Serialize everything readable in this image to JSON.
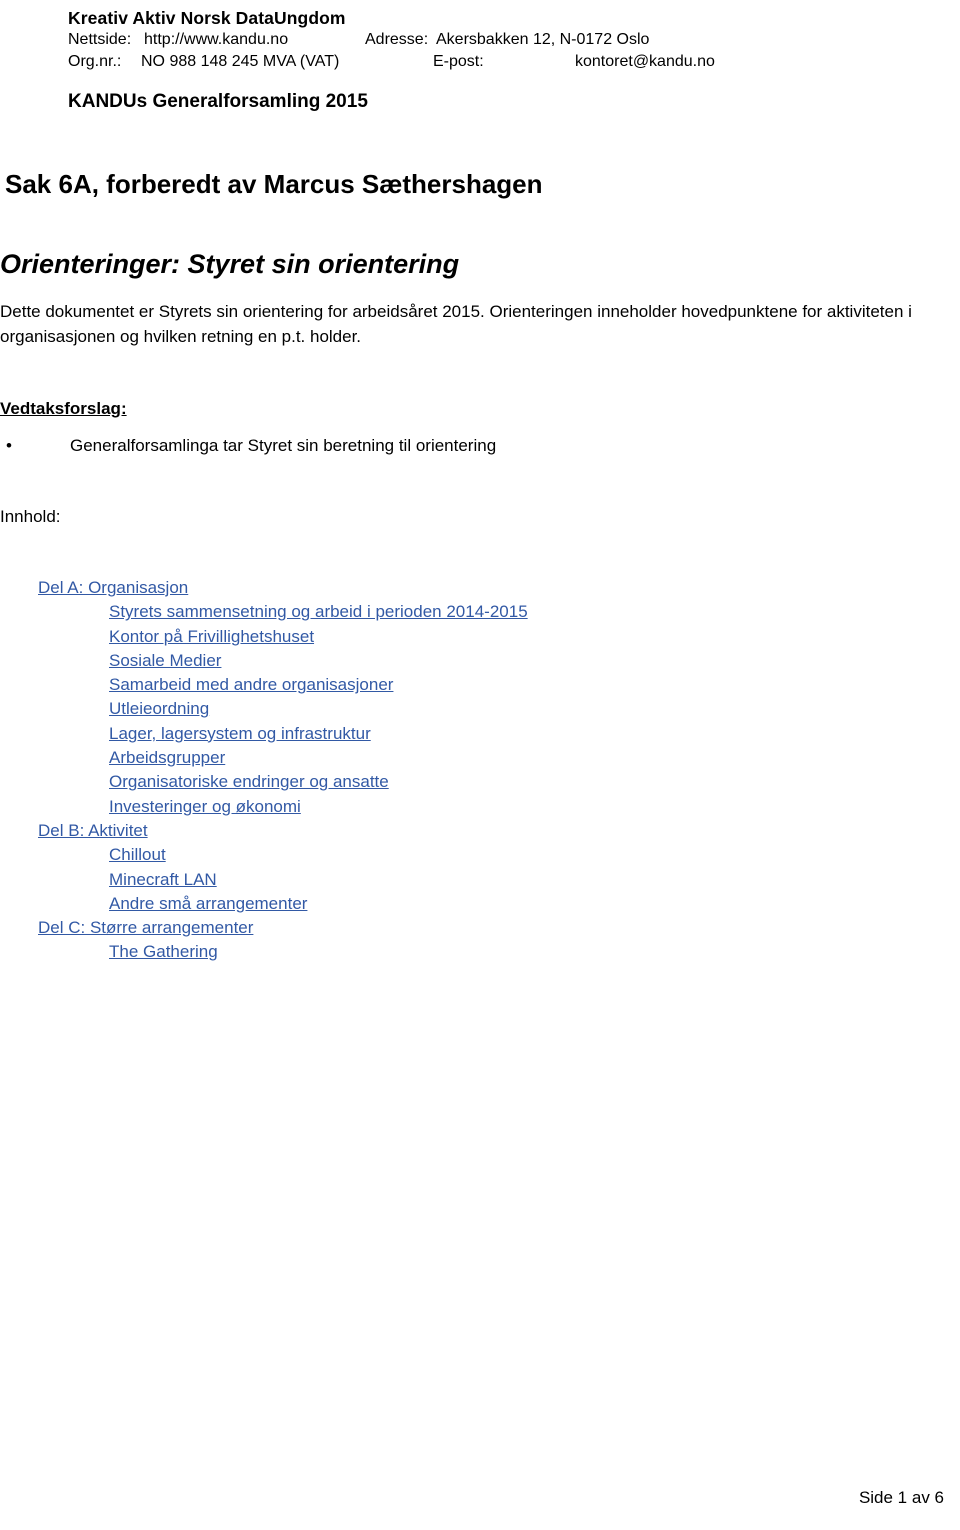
{
  "letterhead": {
    "organization": "Kreativ Aktiv Norsk DataUngdom",
    "website_label": "Nettside:",
    "website_value": "http://www.kandu.no",
    "address_label": "Adresse:",
    "address_value": "Akersbakken 12, N-0172 Oslo",
    "orgnr_label": "Org.nr.:",
    "orgnr_value": "NO 988 148 245 MVA (VAT)",
    "email_label": "E-post:",
    "email_value": "kontoret@kandu.no"
  },
  "document": {
    "meeting_title": "KANDUs Generalforsamling 2015",
    "case_heading": "Sak 6A, forberedt av Marcus Sæthershagen",
    "section_heading": "Orienteringer: Styret sin orientering",
    "intro_paragraph": "Dette dokumentet er Styrets sin orientering for arbeidsåret 2015. Orienteringen inneholder hovedpunktene for aktiviteten i organisasjonen og hvilken retning en p.t. holder.",
    "proposal_heading": "Vedtaksforslag:",
    "proposal_bullet_glyph": "•",
    "proposal_items": [
      "Generalforsamlinga tar Styret sin beretning til orientering"
    ],
    "toc_label": "Innhold:",
    "link_color": "#3259A5"
  },
  "toc": {
    "entries": [
      {
        "label": "Del A: Organisasjon",
        "level": 1
      },
      {
        "label": "Styrets sammensetning og arbeid i perioden 2014-2015",
        "level": 2
      },
      {
        "label": "Kontor på Frivillighetshuset",
        "level": 2
      },
      {
        "label": "Sosiale Medier",
        "level": 2
      },
      {
        "label": "Samarbeid med andre organisasjoner",
        "level": 2
      },
      {
        "label": "Utleieordning",
        "level": 2
      },
      {
        "label": "Lager, lagersystem og infrastruktur",
        "level": 2
      },
      {
        "label": "Arbeidsgrupper",
        "level": 2
      },
      {
        "label": "Organisatoriske endringer og ansatte",
        "level": 2
      },
      {
        "label": "Investeringer og økonomi",
        "level": 2
      },
      {
        "label": "Del B: Aktivitet",
        "level": 1
      },
      {
        "label": "Chillout",
        "level": 2
      },
      {
        "label": "Minecraft LAN",
        "level": 2
      },
      {
        "label": "Andre små arrangementer",
        "level": 2
      },
      {
        "label": "Del C: Større arrangementer",
        "level": 1
      },
      {
        "label": "The Gathering",
        "level": 2
      }
    ]
  },
  "footer": {
    "page_label": "Side 1 av 6"
  }
}
